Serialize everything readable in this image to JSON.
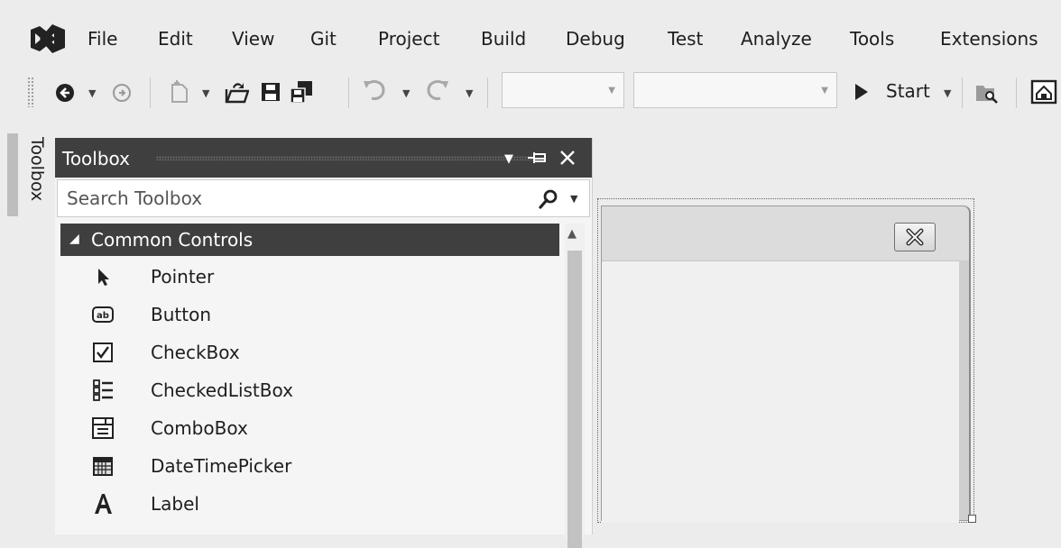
{
  "menu": [
    "File",
    "Edit",
    "View",
    "Git",
    "Project",
    "Build",
    "Debug",
    "Test",
    "Analyze",
    "Tools",
    "Extensions"
  ],
  "toolbar": {
    "start_label": "Start"
  },
  "side_tab": {
    "label": "Toolbox"
  },
  "toolbox": {
    "title": "Toolbox",
    "search_placeholder": "Search Toolbox",
    "category": "Common Controls",
    "items": [
      {
        "label": "Pointer",
        "icon": "pointer-icon"
      },
      {
        "label": "Button",
        "icon": "button-icon"
      },
      {
        "label": "CheckBox",
        "icon": "checkbox-icon"
      },
      {
        "label": "CheckedListBox",
        "icon": "checked-list-box-icon"
      },
      {
        "label": "ComboBox",
        "icon": "combobox-icon"
      },
      {
        "label": "DateTimePicker",
        "icon": "date-time-picker-icon"
      },
      {
        "label": "Label",
        "icon": "label-icon"
      }
    ]
  }
}
